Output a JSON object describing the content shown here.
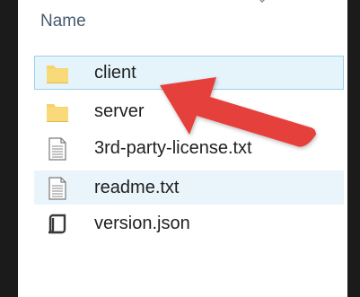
{
  "header": {
    "column_label": "Name"
  },
  "files": [
    {
      "name": "client",
      "icon": "folder-icon",
      "state": "hover"
    },
    {
      "name": "server",
      "icon": "folder-icon",
      "state": "normal"
    },
    {
      "name": "3rd-party-license.txt",
      "icon": "text-file-icon",
      "state": "normal"
    },
    {
      "name": "readme.txt",
      "icon": "text-file-icon",
      "state": "selected"
    },
    {
      "name": "version.json",
      "icon": "json-file-icon",
      "state": "normal"
    }
  ],
  "annotation": {
    "type": "arrow",
    "color": "#e5413b",
    "points_to": "client"
  },
  "colors": {
    "hover_bg": "#e5f3fb",
    "hover_border": "#99d1ef",
    "selected_bg": "#eaf4fb",
    "folder": "#f6d36b",
    "header_text": "#4a5a6e"
  }
}
